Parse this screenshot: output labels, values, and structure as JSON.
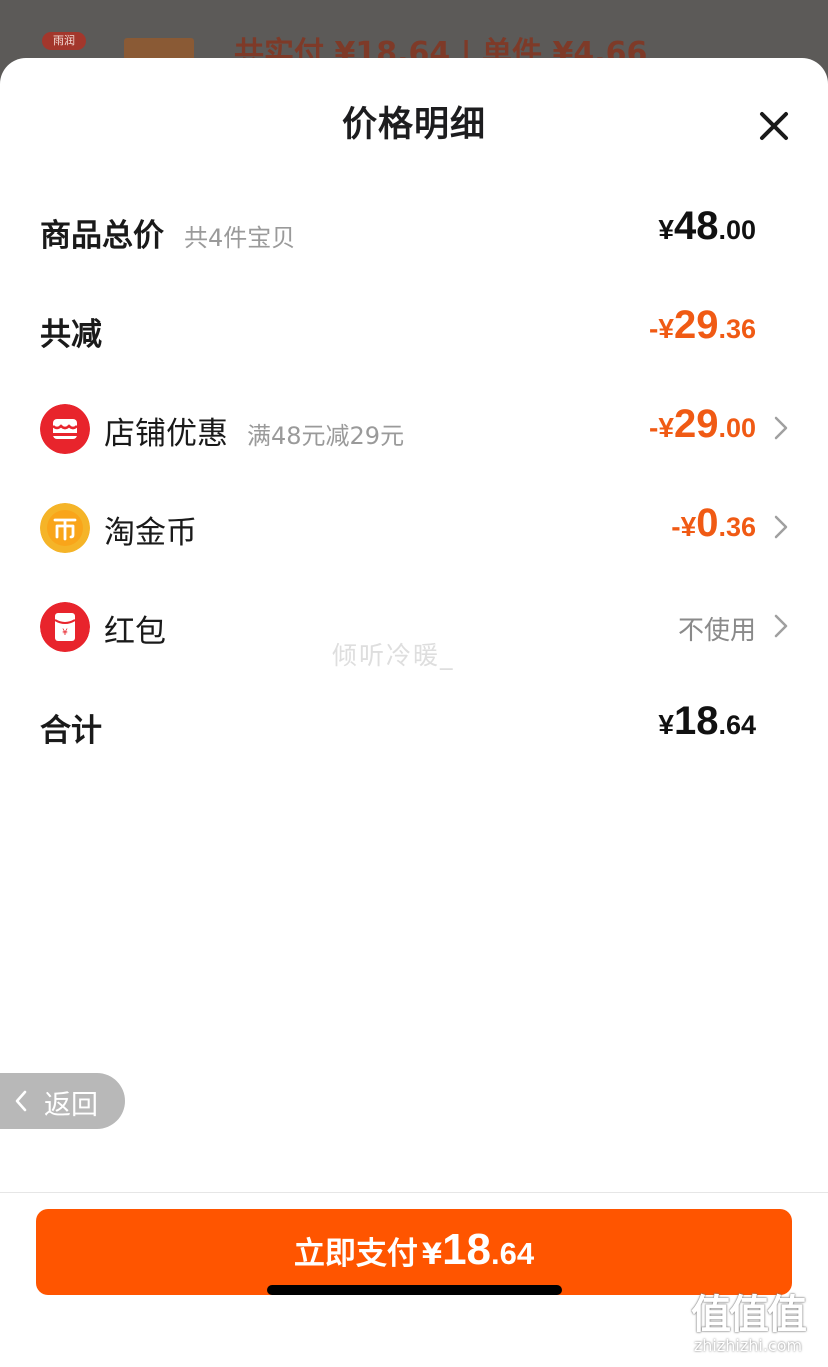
{
  "background": {
    "logo_text": "雨润",
    "peek_text": "共实付 ¥18.64 | 单件 ¥4.66"
  },
  "sheet": {
    "title": "价格明细",
    "close_icon": "close-icon"
  },
  "rows": {
    "total": {
      "label": "商品总价",
      "sub": "共4件宝贝",
      "symbol": "¥",
      "int": "48",
      "dec": ".00"
    },
    "reduction": {
      "label": "共减",
      "symbol": "-¥",
      "int": "29",
      "dec": ".36"
    },
    "shop_discount": {
      "icon": "shop-icon",
      "label": "店铺优惠",
      "sub": "满48元减29元",
      "symbol": "-¥",
      "int": "29",
      "dec": ".00"
    },
    "taojinbi": {
      "icon": "coin-icon",
      "label": "淘金币",
      "symbol": "-¥",
      "int": "0",
      "dec": ".36"
    },
    "hongbao": {
      "icon": "red-packet-icon",
      "label": "红包",
      "value": "不使用"
    },
    "sum": {
      "label": "合计",
      "symbol": "¥",
      "int": "18",
      "dec": ".64"
    }
  },
  "watermark": "倾听冷暖_",
  "back_button": {
    "label": "返回"
  },
  "pay_button": {
    "label": "立即支付",
    "symbol": "¥",
    "int": "18",
    "dec": ".64"
  },
  "site": {
    "glyph": "值值值",
    "url": "zhizhizhi.com"
  },
  "colors": {
    "accent": "#ff5500",
    "discount": "#f05a14",
    "shop_icon": "#e8242c",
    "coin_icon": "#f5b428",
    "red_packet_icon": "#e8242c"
  }
}
